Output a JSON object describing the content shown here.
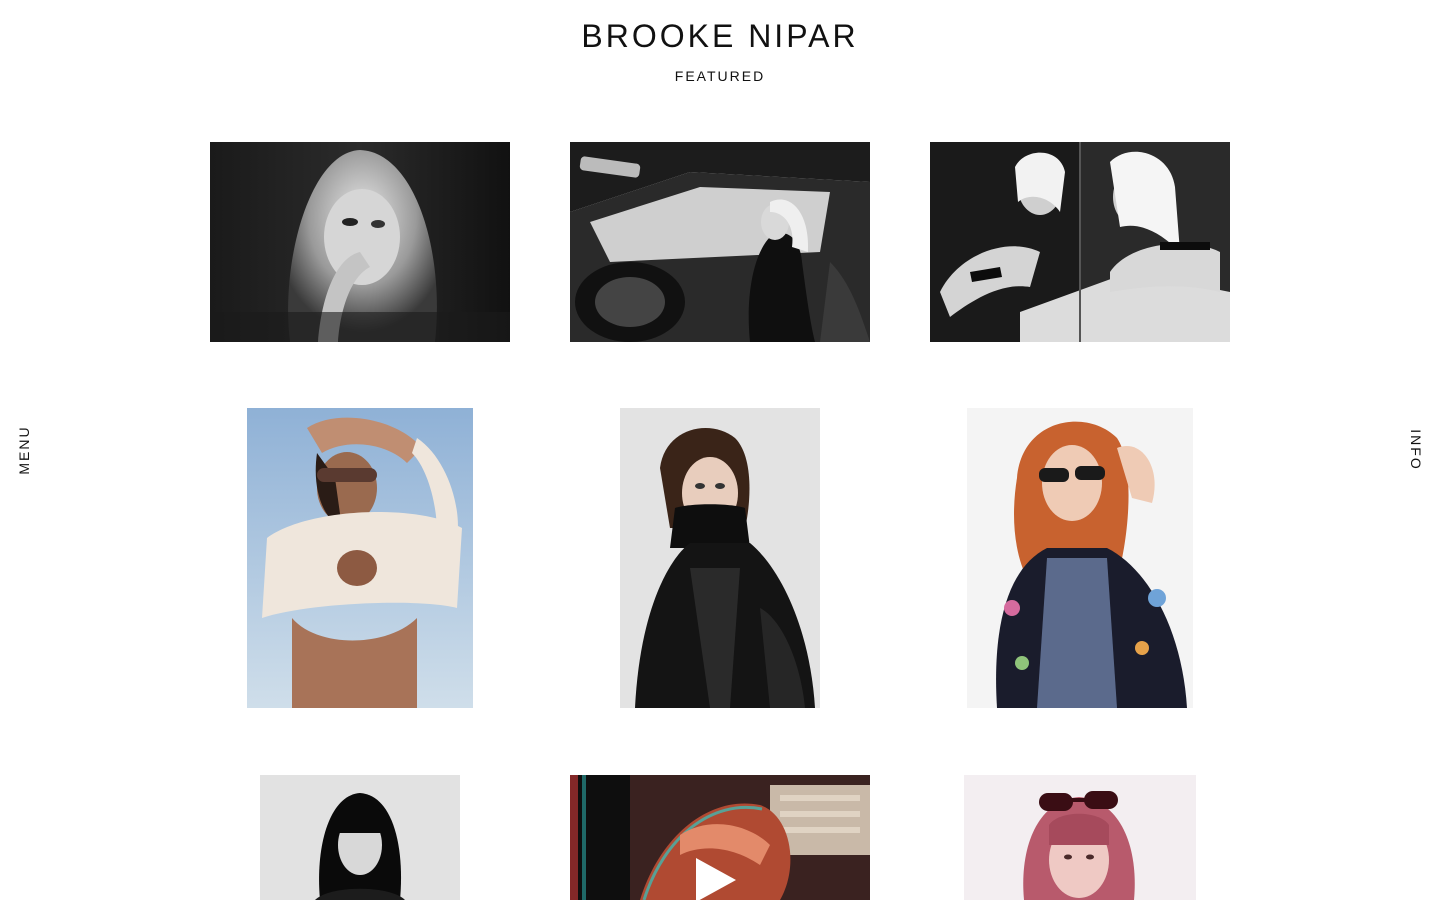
{
  "header": {
    "title": "BROOKE NIPAR",
    "section": "FEATURED"
  },
  "nav": {
    "menu_label": "MENU",
    "info_label": "INFO"
  },
  "gallery": {
    "items": [
      {
        "tone": "bw"
      },
      {
        "tone": "bw"
      },
      {
        "tone": "bw"
      },
      {
        "tone": "color"
      },
      {
        "tone": "color"
      },
      {
        "tone": "color"
      },
      {
        "tone": "bw"
      },
      {
        "tone": "color",
        "media": "video"
      },
      {
        "tone": "color"
      }
    ],
    "play_icon": "play-icon"
  },
  "colors": {
    "background": "#ffffff",
    "text": "#111111"
  }
}
